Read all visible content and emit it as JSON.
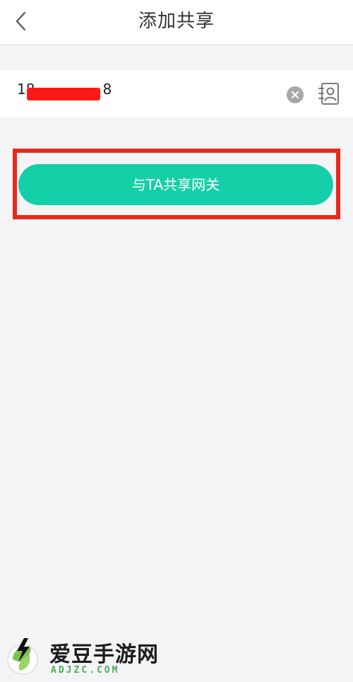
{
  "header": {
    "title": "添加共享",
    "back_icon": "chevron-left-icon"
  },
  "input": {
    "value": "18",
    "value_end": "8",
    "clear_icon": "clear-circle-icon",
    "contact_icon": "contact-book-icon"
  },
  "actions": {
    "share_label": "与TA共享网关"
  },
  "watermark": {
    "brand": "爱豆手游网",
    "url": "ADJZC.COM"
  },
  "colors": {
    "accent": "#15cfa8",
    "highlight": "#e8291c",
    "redaction": "#ff1a1a"
  }
}
